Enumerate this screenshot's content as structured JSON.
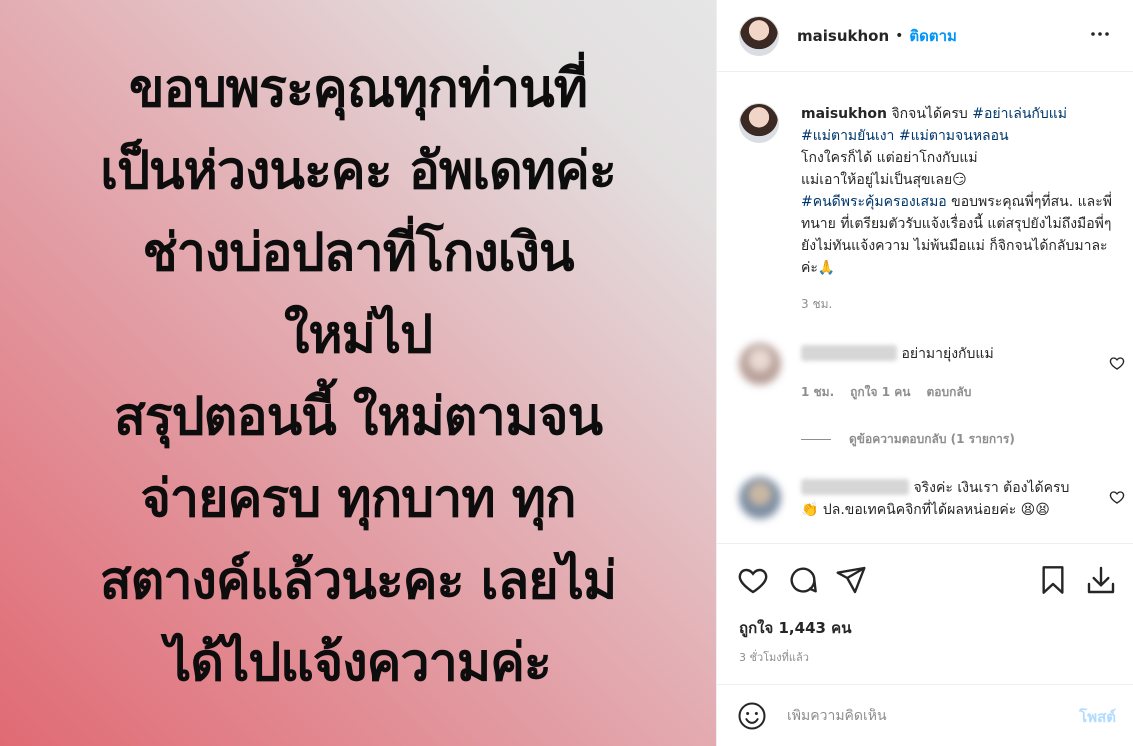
{
  "post_image": {
    "lines": [
      "ขอบพระคุณทุกท่านที่",
      "เป็นห่วงนะคะ อัพเดทค่ะ",
      "ช่างบ่อปลาที่โกงเงิน",
      "ใหม่ไป",
      "สรุปตอนนี้ ใหม่ตามจน",
      "จ่ายครบ ทุกบาท ทุก",
      "สตางค์แล้วนะคะ เลยไม่",
      "ได้ไปแจ้งความค่ะ"
    ]
  },
  "header": {
    "username": "maisukhon",
    "separator": "•",
    "follow_label": "ติดตาม"
  },
  "caption": {
    "username": "maisukhon",
    "text_1": " จิกจนได้ครบ ",
    "tag_1": "#อย่าเล่นกับแม่",
    "tag_2": "#แม่ตามยันเงา",
    "tag_3": "#แม่ตามจนหลอน",
    "text_2": "โกงใครก็ได้ แต่อย่าโกงกับแม่",
    "text_3": "แม่เอาให้อยู่ไม่เป็นสุขเลย😏",
    "tag_4": "#คนดีพระคุ้มครองเสมอ",
    "text_4": " ขอบพระคุณพี่ๆที่สน. และพี่ทนาย ที่เตรียมตัวรับแจ้งเรื่องนี้ แต่สรุปยังไม่ถึงมือพี่ๆ ยังไม่ทันแจ้งความ ไม่พ้นมือแม่ ก็จิกจนได้กลับมาละค่ะ🙏",
    "time": "3 ชม."
  },
  "comments": [
    {
      "text": "อย่ามายุ่งกับแม่",
      "time": "1 ชม.",
      "likes": "ถูกใจ 1 คน",
      "reply_label": "ตอบกลับ"
    },
    {
      "text": "จริงค่ะ เงินเรา ต้องได้ครบ 👏 ปล.ขอเทคนิคจิกที่ได้ผลหน่อยค่ะ 😫😫"
    }
  ],
  "view_replies_label": "ดูข้อความตอบกลับ (1 รายการ)",
  "likes_count": "ถูกใจ 1,443 คน",
  "timestamp": "3 ชั่วโมงที่แล้ว",
  "composer": {
    "placeholder": "เพิ่มความคิดเห็น",
    "post_label": "โพสต์"
  },
  "colors": {
    "accent": "#0095f6",
    "hashtag": "#00376b",
    "muted": "#8e8e8e",
    "post_disabled": "#b3dbff"
  },
  "icons": [
    "more-options-icon",
    "heart-icon",
    "comment-icon",
    "share-icon",
    "bookmark-icon",
    "download-icon",
    "emoji-icon"
  ]
}
